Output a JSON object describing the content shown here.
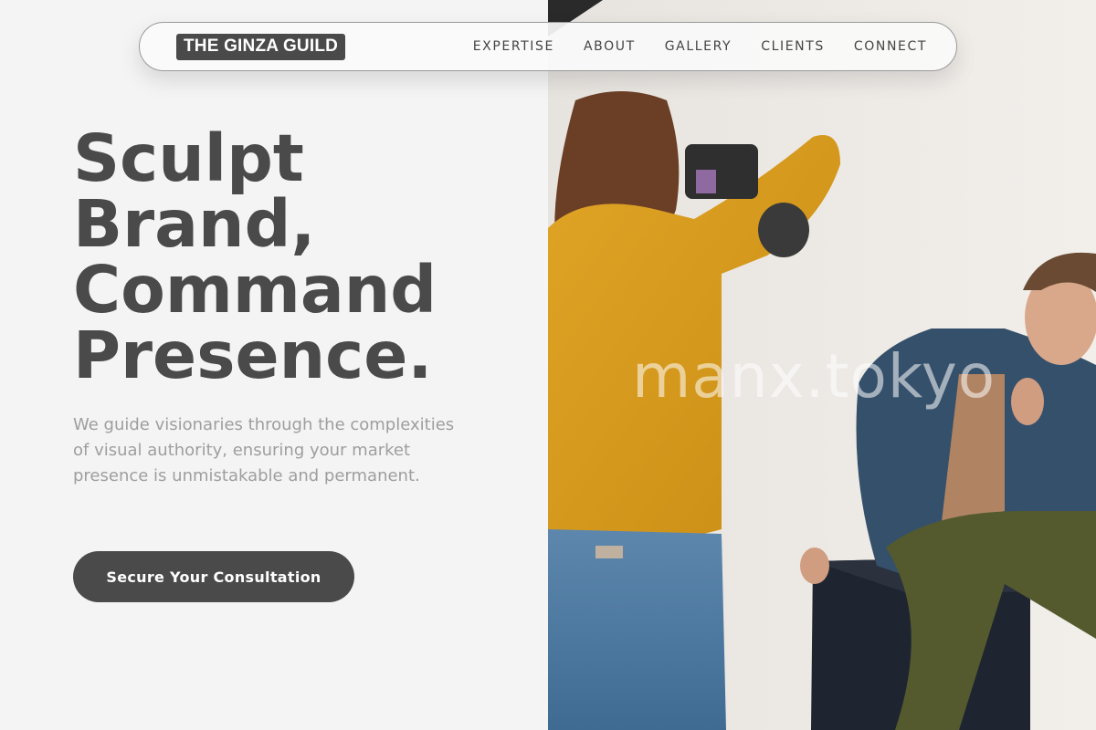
{
  "brand": {
    "name": "THE GINZA GUILD"
  },
  "nav": {
    "links": [
      "EXPERTISE",
      "ABOUT",
      "GALLERY",
      "CLIENTS",
      "CONNECT"
    ]
  },
  "hero": {
    "title_lines": [
      "Sculpt",
      "Brand,",
      "Command",
      "Presence."
    ],
    "subtitle": "We guide visionaries through the complexities of visual authority, ensuring your market presence is unmistakable and permanent.",
    "cta_label": "Secure Your Consultation"
  },
  "image": {
    "watermark": "manx.tokyo",
    "description_icon": "photo-shoot-image"
  },
  "colors": {
    "accent": "#4a4a4a",
    "background": "#f4f4f4",
    "muted_text": "#9e9e9e"
  }
}
